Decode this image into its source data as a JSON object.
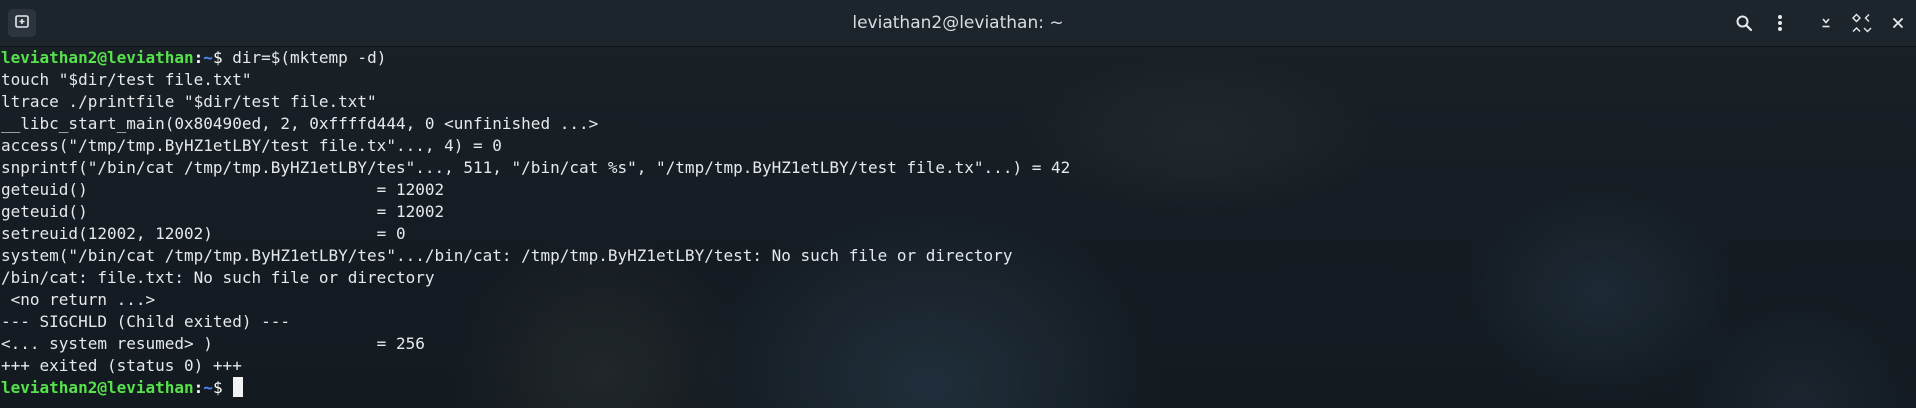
{
  "window": {
    "title": "leviathan2@leviathan: ~",
    "icons": {
      "new_tab": "new-tab-icon",
      "search": "search-icon",
      "menu": "kebab-menu-icon",
      "minimize": "minimize-icon",
      "maximize": "maximize-icon",
      "close": "close-icon"
    }
  },
  "prompt": {
    "user_host": "leviathan2@leviathan",
    "separator": ":",
    "path": "~",
    "symbol": "$ "
  },
  "terminal": {
    "first_command": "dir=$(mktemp -d)",
    "output_lines": [
      "touch \"$dir/test file.txt\"",
      "ltrace ./printfile \"$dir/test file.txt\"",
      "__libc_start_main(0x80490ed, 2, 0xffffd444, 0 <unfinished ...>",
      "access(\"/tmp/tmp.ByHZ1etLBY/test file.tx\"..., 4) = 0",
      "snprintf(\"/bin/cat /tmp/tmp.ByHZ1etLBY/tes\"..., 511, \"/bin/cat %s\", \"/tmp/tmp.ByHZ1etLBY/test file.tx\"...) = 42",
      "geteuid()                              = 12002",
      "geteuid()                              = 12002",
      "setreuid(12002, 12002)                 = 0",
      "system(\"/bin/cat /tmp/tmp.ByHZ1etLBY/tes\".../bin/cat: /tmp/tmp.ByHZ1etLBY/test: No such file or directory",
      "/bin/cat: file.txt: No such file or directory",
      " <no return ...>",
      "--- SIGCHLD (Child exited) ---",
      "<... system resumed> )                 = 256",
      "+++ exited (status 0) +++"
    ],
    "last_command": ""
  },
  "colors": {
    "background": "#141b22",
    "titlebar": "#1d252c",
    "prompt_user": "#55e24a",
    "prompt_path": "#4e8cff",
    "text": "#e6e9ec"
  }
}
